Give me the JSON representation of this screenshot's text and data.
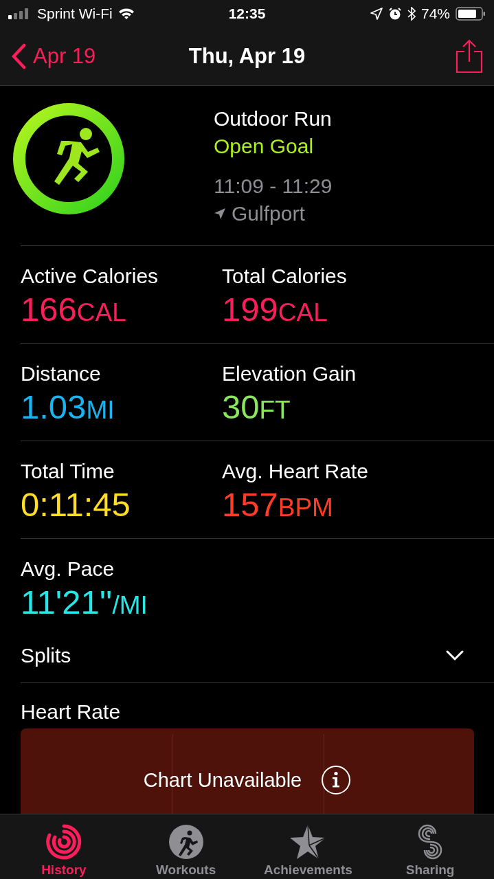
{
  "status_bar": {
    "carrier": "Sprint Wi-Fi",
    "time": "12:35",
    "battery": "74%"
  },
  "nav": {
    "back": "Apr 19",
    "title": "Thu, Apr 19"
  },
  "workout": {
    "name": "Outdoor Run",
    "goal": "Open Goal",
    "time_range": "11:09 - 11:29",
    "location": "Gulfport"
  },
  "metrics": [
    {
      "label": "Active Calories",
      "value": "166",
      "unit": "CAL",
      "color": "#fa1e5a"
    },
    {
      "label": "Total Calories",
      "value": "199",
      "unit": "CAL",
      "color": "#fa1e5a"
    },
    {
      "label": "Distance",
      "value": "1.03",
      "unit": "MI",
      "color": "#19b4f0"
    },
    {
      "label": "Elevation Gain",
      "value": "30",
      "unit": "FT",
      "color": "#8ae65a"
    },
    {
      "label": "Total Time",
      "value": "0:11:45",
      "color": "#ffdc28"
    },
    {
      "label": "Avg. Heart Rate",
      "value": "157",
      "unit": "BPM",
      "color": "#ff3c28"
    },
    {
      "label": "Avg. Pace",
      "value": "11'21''",
      "unit": "/MI",
      "color": "#28e6e6"
    }
  ],
  "splits": {
    "label": "Splits",
    "expanded": false
  },
  "heart_rate": {
    "title": "Heart Rate",
    "message": "Chart Unavailable"
  },
  "tabs": [
    {
      "label": "History",
      "selected": true
    },
    {
      "label": "Workouts",
      "selected": false
    },
    {
      "label": "Achievements",
      "selected": false
    },
    {
      "label": "Sharing",
      "selected": false
    }
  ]
}
